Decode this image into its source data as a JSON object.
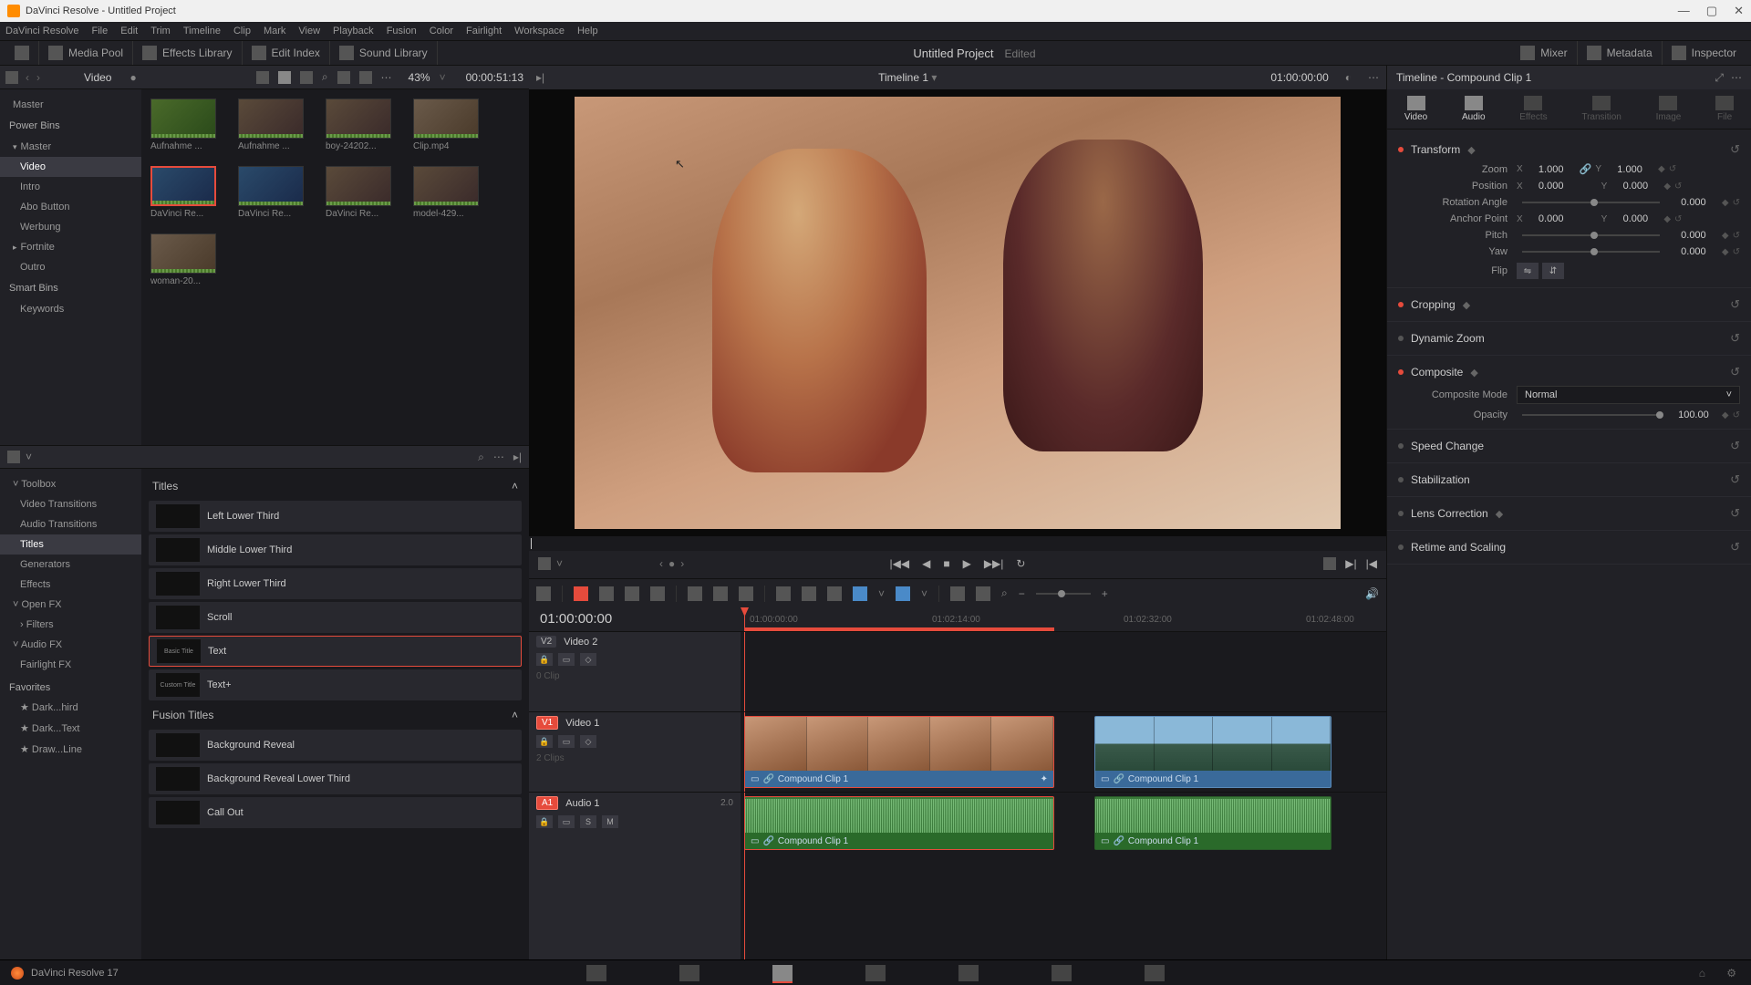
{
  "window": {
    "title": "DaVinci Resolve - Untitled Project"
  },
  "menus": [
    "DaVinci Resolve",
    "File",
    "Edit",
    "Trim",
    "Timeline",
    "Clip",
    "Mark",
    "View",
    "Playback",
    "Fusion",
    "Color",
    "Fairlight",
    "Workspace",
    "Help"
  ],
  "toptool": {
    "media_pool": "Media Pool",
    "effects_library": "Effects Library",
    "edit_index": "Edit Index",
    "sound_library": "Sound Library",
    "project": "Untitled Project",
    "edited": "Edited",
    "mixer": "Mixer",
    "metadata": "Metadata",
    "inspector": "Inspector"
  },
  "mediapool": {
    "bin_label": "Video",
    "zoom_pct": "43%",
    "timecode": "00:00:51:13",
    "tree": {
      "master": "Master",
      "power_bins": "Power Bins",
      "power_master": "Master",
      "items": [
        "Video",
        "Intro",
        "Abo Button",
        "Werbung",
        "Fortnite",
        "Outro"
      ],
      "smart_bins": "Smart Bins",
      "keywords": "Keywords"
    },
    "clips": [
      {
        "name": "Aufnahme ..."
      },
      {
        "name": "Aufnahme ..."
      },
      {
        "name": "boy-24202..."
      },
      {
        "name": "Clip.mp4"
      },
      {
        "name": "DaVinci Re..."
      },
      {
        "name": "DaVinci Re..."
      },
      {
        "name": "DaVinci Re..."
      },
      {
        "name": "model-429..."
      },
      {
        "name": "woman-20..."
      }
    ]
  },
  "fx": {
    "tree": {
      "toolbox": "Toolbox",
      "items": [
        "Video Transitions",
        "Audio Transitions",
        "Titles",
        "Generators",
        "Effects"
      ],
      "openfx": "Open FX",
      "filters": "Filters",
      "audiofx": "Audio FX",
      "fairlightfx": "Fairlight FX",
      "favorites": "Favorites",
      "fav_items": [
        "Dark...hird",
        "Dark...Text",
        "Draw...Line"
      ]
    },
    "titles_hdr": "Titles",
    "titles": [
      "Left Lower Third",
      "Middle Lower Third",
      "Right Lower Third",
      "Scroll",
      "Text",
      "Text+"
    ],
    "title_thumbs": [
      "",
      "",
      "",
      "",
      "Basic Title",
      "Custom Title"
    ],
    "fusion_hdr": "Fusion Titles",
    "fusion": [
      "Background Reveal",
      "Background Reveal Lower Third",
      "Call Out"
    ]
  },
  "viewer": {
    "timeline_name": "Timeline 1",
    "tc_right": "01:00:00:00"
  },
  "timeline": {
    "tc_big": "01:00:00:00",
    "ruler": [
      "01:00:00:00",
      "01:02:14:00",
      "01:02:32:00",
      "01:02:48:00"
    ],
    "v2": {
      "tag": "V2",
      "name": "Video 2",
      "meta": "0 Clip"
    },
    "v1": {
      "tag": "V1",
      "name": "Video 1",
      "meta": "2 Clips"
    },
    "a1": {
      "tag": "A1",
      "name": "Audio 1",
      "ch": "2.0"
    },
    "clip1": "Compound Clip 1",
    "clip2": "Compound Clip 1",
    "aclip1": "Compound Clip 1",
    "aclip2": "Compound Clip 1"
  },
  "inspector": {
    "title": "Timeline - Compound Clip 1",
    "tabs": [
      "Video",
      "Audio",
      "Effects",
      "Transition",
      "Image",
      "File"
    ],
    "transform": {
      "label": "Transform",
      "zoom": {
        "label": "Zoom",
        "x": "1.000",
        "y": "1.000"
      },
      "position": {
        "label": "Position",
        "x": "0.000",
        "y": "0.000"
      },
      "rotation": {
        "label": "Rotation Angle",
        "v": "0.000"
      },
      "anchor": {
        "label": "Anchor Point",
        "x": "0.000",
        "y": "0.000"
      },
      "pitch": {
        "label": "Pitch",
        "v": "0.000"
      },
      "yaw": {
        "label": "Yaw",
        "v": "0.000"
      },
      "flip": {
        "label": "Flip"
      }
    },
    "cropping": "Cropping",
    "dynamic_zoom": "Dynamic Zoom",
    "composite": {
      "label": "Composite",
      "mode_label": "Composite Mode",
      "mode": "Normal",
      "opacity_label": "Opacity",
      "opacity": "100.00"
    },
    "speed_change": "Speed Change",
    "stabilization": "Stabilization",
    "lens_correction": "Lens Correction",
    "retime": "Retime and Scaling"
  },
  "pagebar": {
    "version": "DaVinci Resolve 17"
  }
}
